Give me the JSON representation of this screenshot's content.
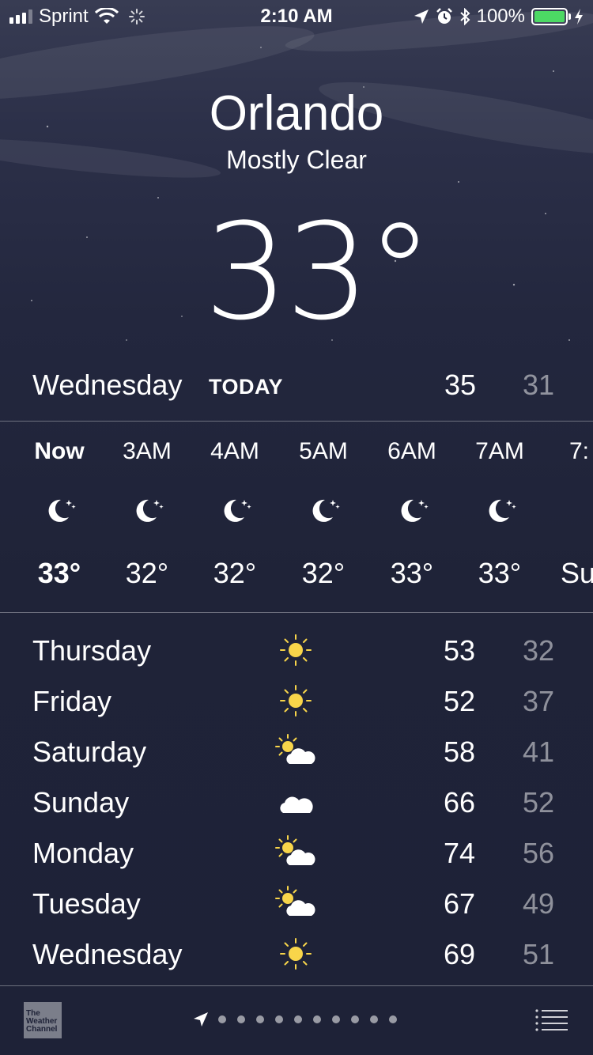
{
  "status_bar": {
    "carrier": "Sprint",
    "time": "2:10 AM",
    "battery": "100%",
    "battery_color": "#4cd964"
  },
  "location": {
    "city": "Orlando",
    "condition": "Mostly Clear",
    "temperature": "33°"
  },
  "today": {
    "day": "Wednesday",
    "label": "TODAY",
    "high": "35",
    "low": "31"
  },
  "hourly": [
    {
      "time": "Now",
      "icon": "moon-stars-icon",
      "temp": "33°"
    },
    {
      "time": "3AM",
      "icon": "moon-stars-icon",
      "temp": "32°"
    },
    {
      "time": "4AM",
      "icon": "moon-stars-icon",
      "temp": "32°"
    },
    {
      "time": "5AM",
      "icon": "moon-stars-icon",
      "temp": "32°"
    },
    {
      "time": "6AM",
      "icon": "moon-stars-icon",
      "temp": "33°"
    },
    {
      "time": "7AM",
      "icon": "moon-stars-icon",
      "temp": "33°"
    },
    {
      "time": "7:",
      "icon": "",
      "temp": "Su"
    }
  ],
  "daily": [
    {
      "day": "Thursday",
      "icon": "sun-icon",
      "high": "53",
      "low": "32"
    },
    {
      "day": "Friday",
      "icon": "sun-icon",
      "high": "52",
      "low": "37"
    },
    {
      "day": "Saturday",
      "icon": "partly-cloudy-icon",
      "high": "58",
      "low": "41"
    },
    {
      "day": "Sunday",
      "icon": "cloud-icon",
      "high": "66",
      "low": "52"
    },
    {
      "day": "Monday",
      "icon": "partly-cloudy-icon",
      "high": "74",
      "low": "56"
    },
    {
      "day": "Tuesday",
      "icon": "partly-cloudy-icon",
      "high": "67",
      "low": "49"
    },
    {
      "day": "Wednesday",
      "icon": "sun-icon",
      "high": "69",
      "low": "51"
    }
  ],
  "footer": {
    "logo_text": "The Weather Channel",
    "page_dots": 10,
    "sun_color": "#f8d54a"
  }
}
